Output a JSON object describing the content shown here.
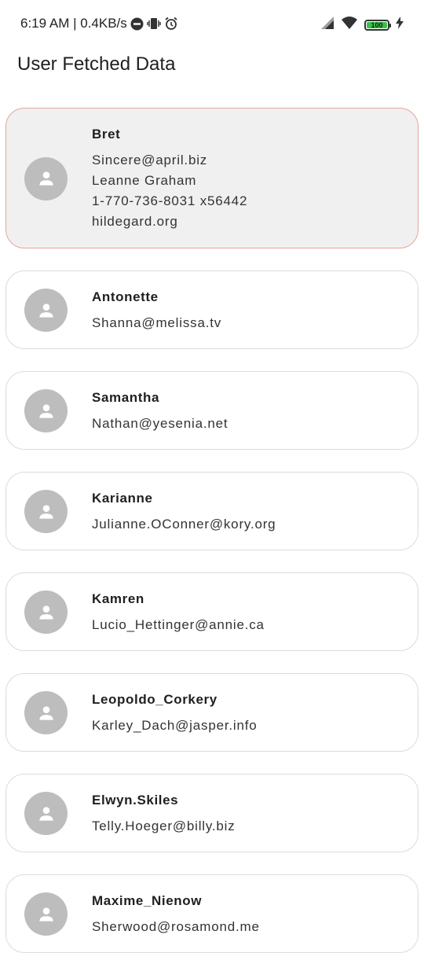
{
  "status_bar": {
    "time_speed": "6:19 AM | 0.4KB/s",
    "battery": "100",
    "icons": [
      "dnd-icon",
      "vibrate-icon",
      "alarm-icon",
      "signal-icon",
      "wifi-icon",
      "battery-icon",
      "charging-icon"
    ]
  },
  "app_bar": {
    "title": "User Fetched Data"
  },
  "users": [
    {
      "username": "Bret",
      "email": "Sincere@april.biz",
      "name": "Leanne Graham",
      "phone": "1-770-736-8031 x56442",
      "website": "hildegard.org",
      "expanded": true
    },
    {
      "username": "Antonette",
      "email": "Shanna@melissa.tv"
    },
    {
      "username": "Samantha",
      "email": "Nathan@yesenia.net"
    },
    {
      "username": "Karianne",
      "email": "Julianne.OConner@kory.org"
    },
    {
      "username": "Kamren",
      "email": "Lucio_Hettinger@annie.ca"
    },
    {
      "username": "Leopoldo_Corkery",
      "email": "Karley_Dach@jasper.info"
    },
    {
      "username": "Elwyn.Skiles",
      "email": "Telly.Hoeger@billy.biz"
    },
    {
      "username": "Maxime_Nienow",
      "email": "Sherwood@rosamond.me"
    }
  ],
  "colors": {
    "selected_card_bg": "#f0f0f0",
    "selected_card_border": "#e7a59d",
    "avatar_bg": "#bdbdbd",
    "battery_fill": "#37c14a"
  }
}
